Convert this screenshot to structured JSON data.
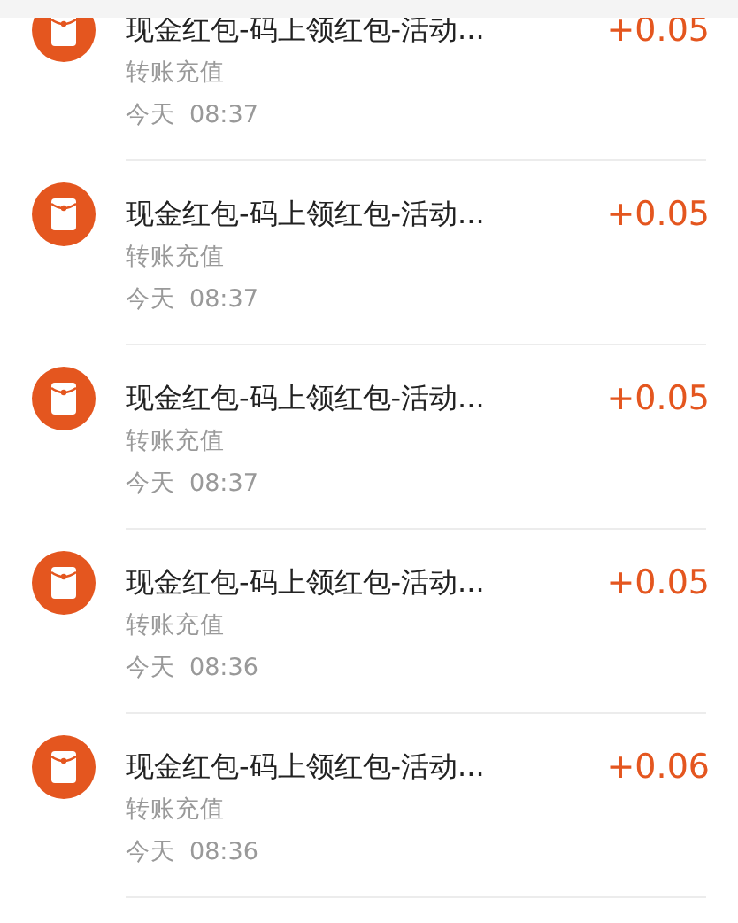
{
  "transactions": [
    {
      "title": "现金红包-码上领红包-活动...",
      "category": "转账充值",
      "date": "今天",
      "time": "08:37",
      "amount": "+0.05"
    },
    {
      "title": "现金红包-码上领红包-活动...",
      "category": "转账充值",
      "date": "今天",
      "time": "08:37",
      "amount": "+0.05"
    },
    {
      "title": "现金红包-码上领红包-活动...",
      "category": "转账充值",
      "date": "今天",
      "time": "08:37",
      "amount": "+0.05"
    },
    {
      "title": "现金红包-码上领红包-活动...",
      "category": "转账充值",
      "date": "今天",
      "time": "08:36",
      "amount": "+0.05"
    },
    {
      "title": "现金红包-码上领红包-活动...",
      "category": "转账充值",
      "date": "今天",
      "time": "08:36",
      "amount": "+0.06"
    }
  ]
}
